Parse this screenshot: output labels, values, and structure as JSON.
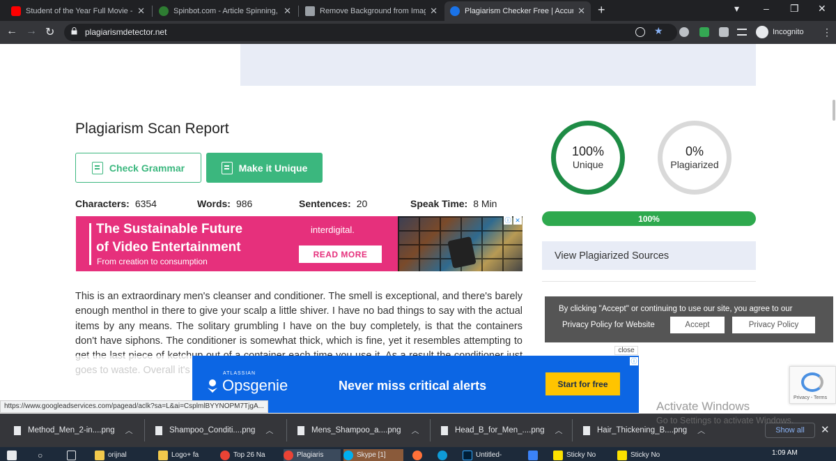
{
  "browser": {
    "tabs": [
      {
        "title": "Student of the Year Full Movie - Y",
        "icon_color": "#ff0000"
      },
      {
        "title": "Spinbot.com - Article Spinning, T",
        "icon_color": "#2e7d32"
      },
      {
        "title": "Remove Background from Image",
        "icon_color": "#9aa0a6"
      },
      {
        "title": "Plagiarism Checker Free | Accura",
        "icon_color": "#1a73e8"
      }
    ],
    "url": "plagiarismdetector.net",
    "profile_label": "Incognito"
  },
  "report": {
    "title": "Plagiarism Scan Report",
    "check_grammar": "Check Grammar",
    "make_unique": "Make it Unique",
    "stats": [
      {
        "label": "Characters:",
        "value": "6354"
      },
      {
        "label": "Words:",
        "value": "986"
      },
      {
        "label": "Sentences:",
        "value": "20"
      },
      {
        "label": "Speak Time:",
        "value": "8 Min"
      }
    ],
    "article": "This is an extraordinary men's cleanser and conditioner. The smell is exceptional, and there's barely enough menthol in there to give your scalp a little shiver. I have no bad things to say with the actual items by any means. The solitary grumbling I have on the buy completely, is that the containers don't have siphons. The conditioner is somewhat thick, which is fine, yet it resembles attempting to get the last piece of ketchup out of a container each time you use it. As a result the conditioner just goes to waste. Overall it's a great thing !!! for your skin the men..."
  },
  "results": {
    "unique_pct": "100%",
    "unique_label": "Unique",
    "unique_color": "#1e8c45",
    "plag_pct": "0%",
    "plag_label": "Plagiarized",
    "plag_color": "#d9d9d9",
    "progress_label": "100%",
    "progress_value": 1.0,
    "view_sources": "View Plagiarized Sources"
  },
  "ad_top": {
    "line1": "The Sustainable Future",
    "line2": "of Video Entertainment",
    "sub": "From creation to consumption",
    "brand": "interdigital.",
    "cta": "READ MORE"
  },
  "cookie": {
    "message": "By clicking \"Accept\" or continuing to use our site, you agree to our",
    "link": "Privacy Policy for Website",
    "accept": "Accept",
    "policy": "Privacy Policy"
  },
  "ad_bottom": {
    "close": "close",
    "atlassian": "ATLASSIAN",
    "brand": "Opsgenie",
    "tagline": "Never miss critical alerts",
    "cta": "Start for free"
  },
  "recaptcha_text": "Privacy - Terms",
  "status_url": "https://www.googleadservices.com/pagead/aclk?sa=L&ai=CsplmlBYYNOPM7TjgA...",
  "watermark": {
    "line1": "Activate Windows",
    "line2": "Go to Settings to activate Windows."
  },
  "downloads": [
    "Method_Men_2-in....png",
    "Shampoo_Conditi....png",
    "Mens_Shampoo_a....png",
    "Head_B_for_Men_....png",
    "Hair_Thickening_B....png"
  ],
  "show_all": "Show all",
  "taskbar": {
    "items": [
      "orijnal",
      "Logo+ fa",
      "Top 26 Na",
      "Plagiaris",
      "Skype [1]",
      "",
      "",
      "Untitled-",
      "",
      "Sticky No",
      "Sticky No"
    ],
    "time": "1:09 AM"
  }
}
